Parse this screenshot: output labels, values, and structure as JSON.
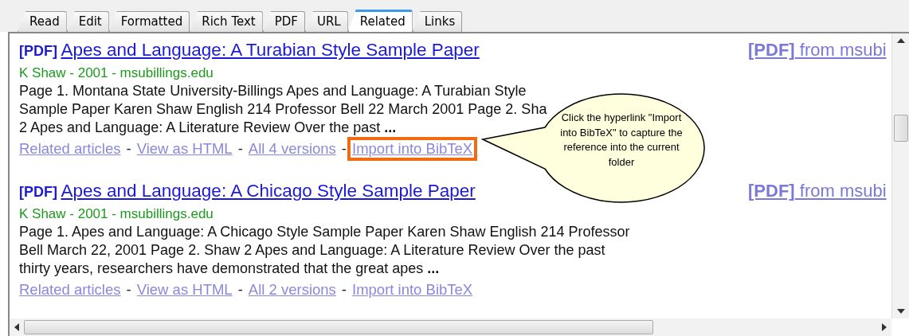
{
  "tabs": [
    {
      "label": "Read",
      "selected": false
    },
    {
      "label": "Edit",
      "selected": false
    },
    {
      "label": "Formatted",
      "selected": false
    },
    {
      "label": "Rich Text",
      "selected": false
    },
    {
      "label": "PDF",
      "selected": false
    },
    {
      "label": "URL",
      "selected": false
    },
    {
      "label": "Related",
      "selected": true
    },
    {
      "label": "Links",
      "selected": false
    }
  ],
  "separator": "-",
  "results": [
    {
      "format": "[PDF]",
      "title": "Apes and Language: A Turabian Style Sample Paper",
      "source_format": "[PDF]",
      "source": "from msubi",
      "meta": "K Shaw - 2001 - msubillings.edu",
      "snippet": [
        "Page 1. Montana State University-Billings Apes and Language: A Turabian Style",
        "Sample Paper Karen Shaw English 214 Professor Bell 22 March 2001 Page 2. Sha",
        "2 Apes and Language: A Literature Review Over the past **...**"
      ],
      "links": [
        {
          "label": "Related articles",
          "highlighted": false
        },
        {
          "label": "View as HTML",
          "highlighted": false
        },
        {
          "label": "All 4 versions",
          "highlighted": false
        },
        {
          "label": "Import into BibTeX",
          "highlighted": true
        }
      ]
    },
    {
      "format": "[PDF]",
      "title": "Apes and Language: A Chicago Style Sample Paper",
      "source_format": "[PDF]",
      "source": "from msubi",
      "meta": "K Shaw - 2001 - msubillings.edu",
      "snippet": [
        "Page 1. Apes and Language: A Chicago Style Sample Paper Karen Shaw English 214 Professor",
        "Bell March 22, 2001 Page 2. Shaw 2 Apes and Language: A Literature Review Over the past",
        "thirty years, researchers have demonstrated that the great apes **...**"
      ],
      "links": [
        {
          "label": "Related articles",
          "highlighted": false
        },
        {
          "label": "View as HTML",
          "highlighted": false
        },
        {
          "label": "All 2 versions",
          "highlighted": false
        },
        {
          "label": "Import into BibTeX",
          "highlighted": false
        }
      ]
    }
  ],
  "callout": {
    "text": "Click the hyperlink \"Import into BibTeX\" to capture the reference into the current folder"
  }
}
